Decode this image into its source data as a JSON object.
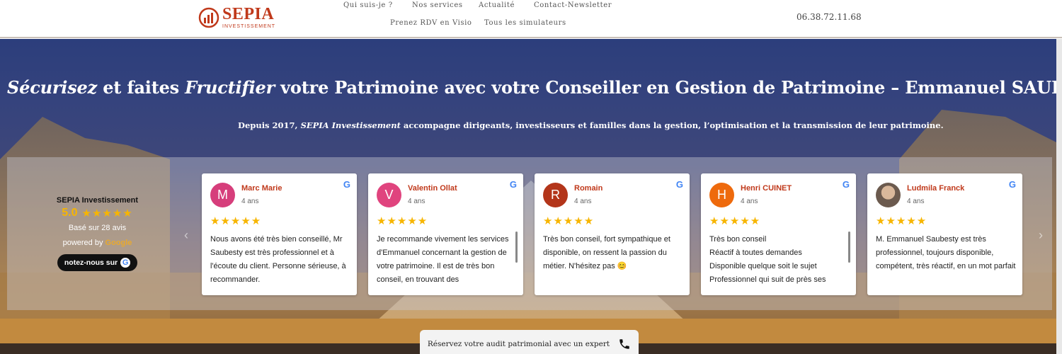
{
  "header": {
    "logo_name": "SEPIA",
    "logo_sub": "INVESTISSEMENT",
    "nav": [
      "Qui suis-je ?",
      "Nos services",
      "Actualité",
      "Contact-Newsletter",
      "Prenez RDV en Visio",
      "Tous les simulateurs"
    ],
    "phone": "06.38.72.11.68"
  },
  "hero": {
    "title_part1": "Sécurisez",
    "title_part2": " et faites ",
    "title_part3": "Fructifier",
    "title_part4": " votre Patrimoine avec votre Conseiller en Gestion de Patrimoine – Emmanuel SAUBESTY",
    "sub_part1": "Depuis 2017, ",
    "sub_part2": "SEPIA Investissement",
    "sub_part3": " accompagne dirigeants, investisseurs et familles dans la gestion, l’optimisation et la transmission de leur patrimoine."
  },
  "summary": {
    "name": "SEPIA Investissement",
    "score": "5.0",
    "stars": "★★★★★",
    "count": "Basé sur 28 avis",
    "powered": "powered by",
    "powered_brand": "Google",
    "cta": "notez-nous sur",
    "cta_icon": "G"
  },
  "nav_arrows": {
    "prev": "‹",
    "next": "›"
  },
  "reviews": [
    {
      "initial": "M",
      "name": "Marc Marie",
      "age": "4 ans",
      "stars": "★★★★★",
      "color": "#d63e7b",
      "text": "Nous avons été très bien conseillé, Mr Saubesty est très professionnel et à l'écoute du client. Personne sérieuse, à recommander.",
      "google": "G"
    },
    {
      "initial": "V",
      "name": "Valentin Ollat",
      "age": "4 ans",
      "stars": "★★★★★",
      "color": "#e0447e",
      "text": "Je recommande vivement les services d'Emmanuel concernant la gestion de votre patrimoine. Il est de très bon conseil, en trouvant des",
      "google": "G"
    },
    {
      "initial": "R",
      "name": "Romain",
      "age": "4 ans",
      "stars": "★★★★★",
      "color": "#b3351a",
      "text": "Très bon conseil, fort sympathique et disponible, on ressent la passion du métier. N'hésitez pas 😊",
      "google": "G"
    },
    {
      "initial": "H",
      "name": "Henri CUINET",
      "age": "4 ans",
      "stars": "★★★★★",
      "color": "#ee6a0d",
      "text": "Très bon conseil\nRéactif à toutes demandes\nDisponible quelque soit le sujet\nProfessionnel qui suit de près ses",
      "google": "G"
    },
    {
      "initial": "",
      "name": "Ludmila Franck",
      "age": "4 ans",
      "stars": "★★★★★",
      "color": "#6b5a4e",
      "text": "M. Emmanuel Saubesty est très professionnel, toujours disponible, compétent, très réactif, en un mot parfait",
      "google": "G"
    }
  ],
  "cta": {
    "label": "Réservez votre audit patrimonial avec un expert",
    "icon": "phone-icon"
  }
}
